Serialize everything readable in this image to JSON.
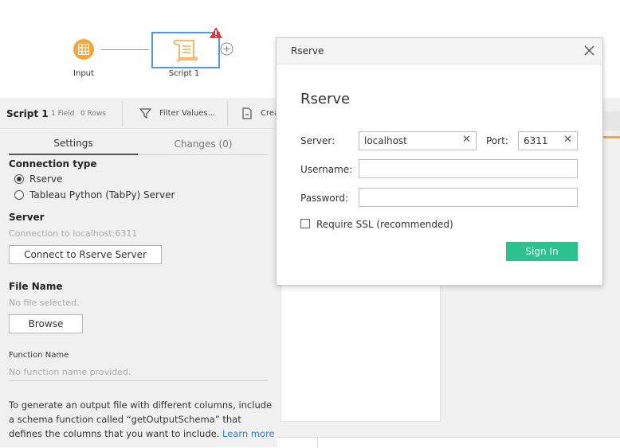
{
  "flow": {
    "input_label": "Input",
    "script_label": "Script 1"
  },
  "panel_header": {
    "title": "Script 1",
    "fields": "1 Field",
    "rows": "0 Rows",
    "filter_label": "Filter Values...",
    "create_label": "Crea"
  },
  "tabs": {
    "settings": "Settings",
    "changes": "Changes (0)"
  },
  "settings": {
    "connection_type_title": "Connection type",
    "option_rserve": "Rserve",
    "option_tabpy": "Tableau Python (TabPy) Server",
    "server_title": "Server",
    "server_status": "Connection to localhost:6311",
    "connect_button": "Connect to Rserve Server",
    "file_name_title": "File Name",
    "file_status": "No file selected.",
    "browse_button": "Browse",
    "function_name_title": "Function Name",
    "function_status": "No function name provided.",
    "info_line1": "To generate an output file with different columns, include",
    "info_line2": "a schema function called “getOutputSchema” that",
    "info_line3": "defines the columns that you want to include.",
    "learn_more": "Learn more"
  },
  "dialog": {
    "title": "Rserve",
    "heading": "Rserve",
    "server_label": "Server:",
    "server_value": "localhost",
    "port_label": "Port:",
    "port_value": "6311",
    "username_label": "Username:",
    "password_label": "Password:",
    "ssl_label": "Require SSL (recommended)",
    "signin_button": "Sign In"
  },
  "colors": {
    "accent_orange": "#f5a442",
    "node_border": "#4a9edc",
    "warning_red": "#e0373f",
    "signin_green": "#2dc18f"
  }
}
